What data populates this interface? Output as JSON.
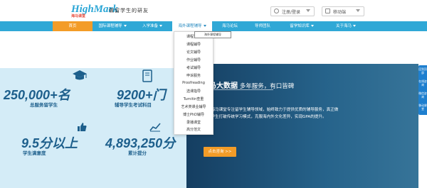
{
  "header": {
    "logo_text": "HighMark",
    "logo_sub": "海马课堂",
    "slogan": "做留学生的研友",
    "login_label": "注册/登录",
    "mobile_label": "移动端"
  },
  "nav": {
    "items": [
      {
        "label": "首页"
      },
      {
        "label": "国际课程辅导"
      },
      {
        "label": "入学准备"
      },
      {
        "label": "海外课程辅导"
      },
      {
        "label": "海马论坛"
      },
      {
        "label": "导师团队"
      },
      {
        "label": "留学知识库"
      },
      {
        "label": "关于海马"
      }
    ]
  },
  "dropdown": {
    "tooltip": "海外课程辅导",
    "items": [
      "课程预习",
      "课程辅导",
      "论文辅导",
      "作业辅导",
      "考试辅导",
      "申诉服务",
      "Proofreading",
      "选课指导",
      "Turnitin查重",
      "艺术类课业辅导",
      "博士PhD辅导",
      "录播课堂",
      "高分范文"
    ]
  },
  "stats": [
    {
      "number": "250,000+名",
      "label": "总服务留学生"
    },
    {
      "number": "9200+门",
      "label": "辅导学生考试科目"
    },
    {
      "number": "9.5分以上",
      "label": "学生满意度"
    },
    {
      "number": "4,893,250分",
      "label": "累计提分"
    }
  ],
  "hero": {
    "title_main": "海马大数据",
    "title_rest": " 多年服务，有口皆碑",
    "desc": "多年来，海马课堂专注留学生辅导领域，始终致力于提供优质的辅导服务，真正做到了精细学生打破传统学习模式，克服海内外文化差异，实现GPA的提升。",
    "button": "点击咨询 >>"
  },
  "sidefloat": {
    "items": [
      "回到顶部",
      "在线咨询",
      "微信咨询",
      "移动课堂"
    ]
  },
  "colors": {
    "nav_bg": "#30a8d6",
    "accent_orange": "#f39c28",
    "stats_bg": "#d4ecf7",
    "stats_text": "#1d5f8c"
  }
}
